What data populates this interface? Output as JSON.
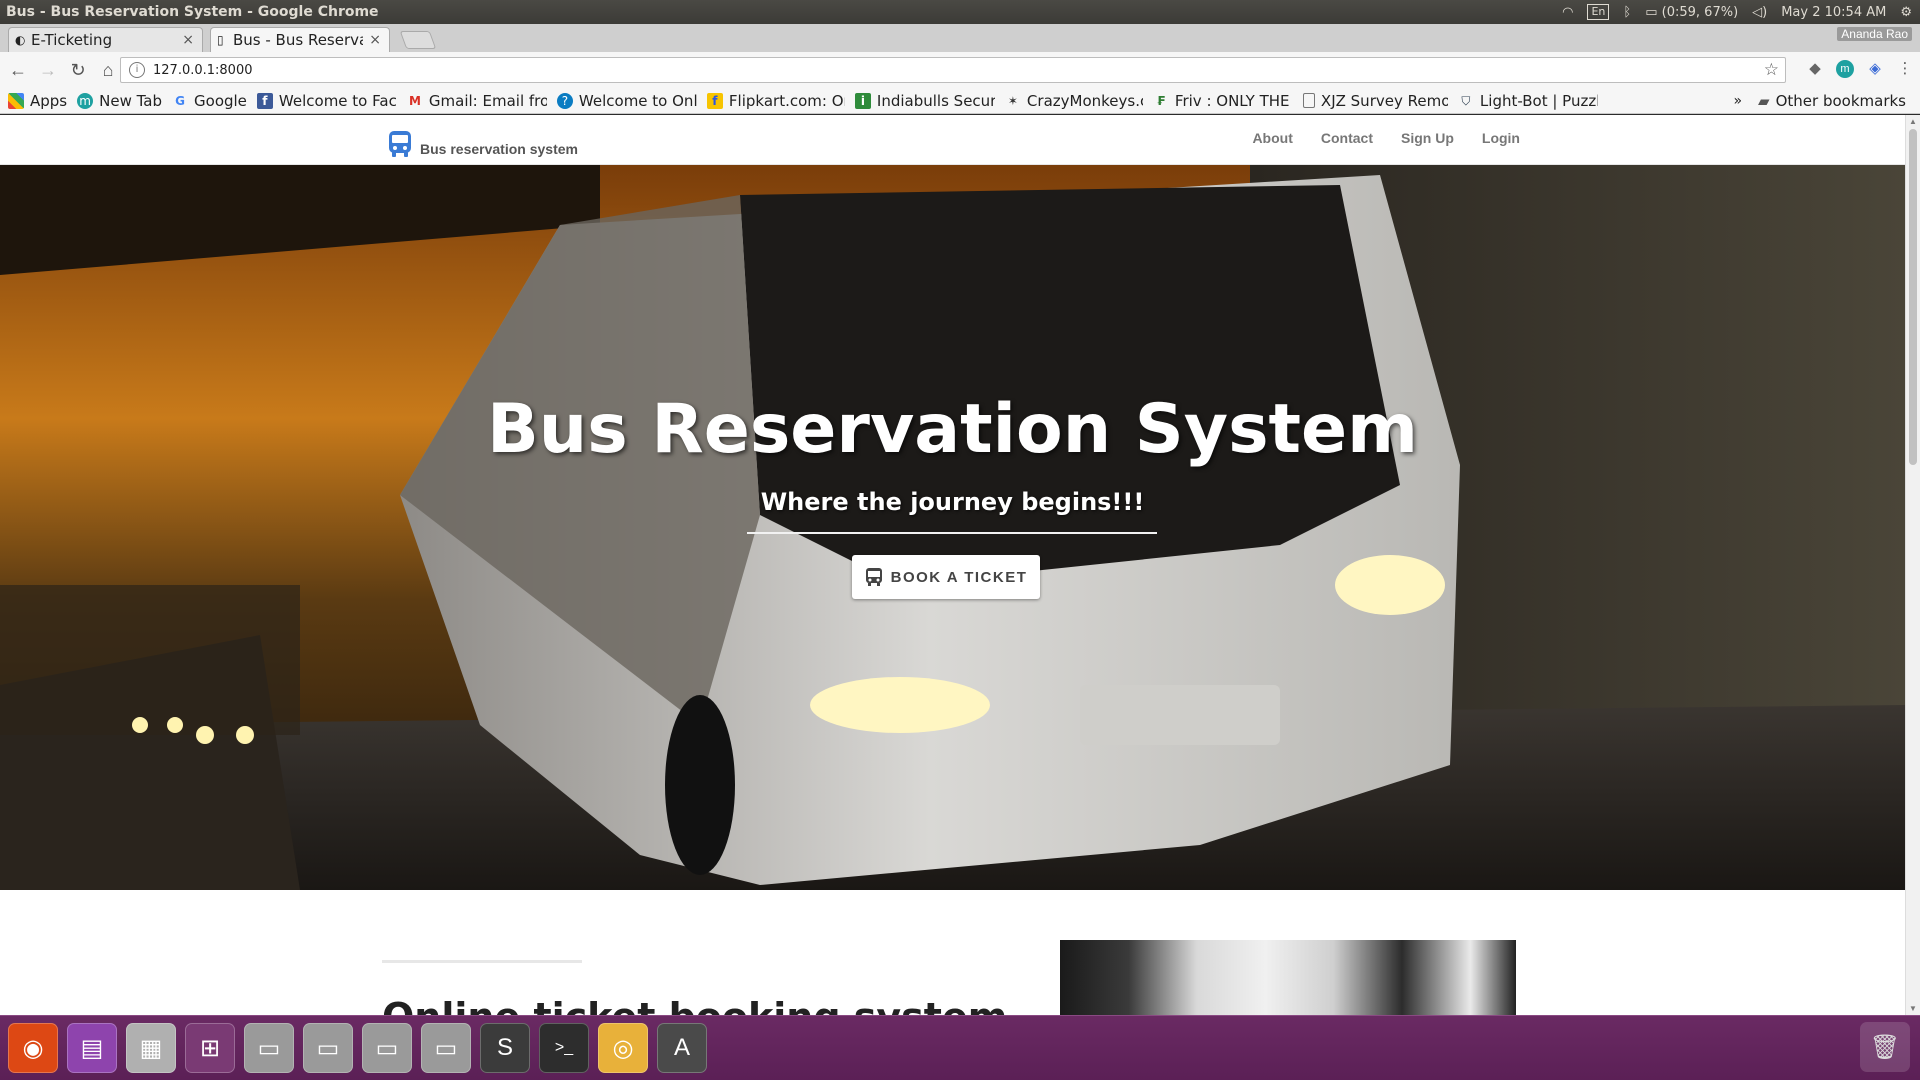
{
  "system": {
    "window_title": "Bus - Bus Reservation System - Google Chrome",
    "keyboard_layout": "En",
    "battery": "(0:59, 67%)",
    "datetime": "May 2 10:54 AM"
  },
  "browser": {
    "tabs": [
      {
        "label": "E-Ticketing",
        "close": "×",
        "icon": "eticket-icon"
      },
      {
        "label": "Bus - Bus Reservati",
        "close": "×",
        "icon": "page-icon"
      }
    ],
    "profile": "Ananda Rao",
    "url": "127.0.0.1:8000",
    "info_glyph": "i",
    "bookmarks": [
      {
        "label": "Apps",
        "icon": "apps-icon",
        "color": "#4285f4"
      },
      {
        "label": "New Tab",
        "icon": "newtab-icon",
        "color": "#1ea1a1"
      },
      {
        "label": "Google",
        "icon": "google-icon",
        "color": "#4285f4"
      },
      {
        "label": "Welcome to Face",
        "icon": "facebook-icon",
        "color": "#3b5998"
      },
      {
        "label": "Gmail: Email fron",
        "icon": "gmail-icon",
        "color": "#d93025"
      },
      {
        "label": "Welcome to Onli",
        "icon": "globe-icon",
        "color": "#0a7cc2"
      },
      {
        "label": "Flipkart.com: On",
        "icon": "flipkart-icon",
        "color": "#f7c400"
      },
      {
        "label": "Indiabulls Securi",
        "icon": "indiabulls-icon",
        "color": "#2e8b3a"
      },
      {
        "label": "CrazyMonkeys.cc",
        "icon": "monkey-icon",
        "color": "#333333"
      },
      {
        "label": "Friv : ONLY THE V",
        "icon": "friv-icon",
        "color": "#2e7d32"
      },
      {
        "label": "XJZ Survey Remo",
        "icon": "page-icon",
        "color": "#777777"
      },
      {
        "label": "Light-Bot | Puzzle",
        "icon": "shield-icon",
        "color": "#2c3e50"
      }
    ],
    "more": "»",
    "other_bookmarks": "Other bookmarks"
  },
  "site": {
    "brand": "Bus reservation system",
    "nav": [
      "About",
      "Contact",
      "Sign Up",
      "Login"
    ],
    "hero": {
      "title": "Bus Reservation System",
      "subtitle": "Where the journey begins!!!",
      "button": "BOOK A TICKET"
    },
    "section_title": "Online ticket booking system"
  },
  "launcher": {
    "apps": [
      {
        "name": "ubuntu-dash-icon",
        "glyph": "◉",
        "color": "#dd4814"
      },
      {
        "name": "files-icon",
        "glyph": "▤",
        "color": "#8e44ad"
      },
      {
        "name": "archive-manager-icon",
        "glyph": "▦",
        "color": "#b0b0b0"
      },
      {
        "name": "workspace-switcher-icon",
        "glyph": "⊞",
        "color": "#7a3a74"
      },
      {
        "name": "disk-icon",
        "glyph": "▭",
        "color": "#9a9a9a"
      },
      {
        "name": "disk-icon",
        "glyph": "▭",
        "color": "#9a9a9a"
      },
      {
        "name": "disk-icon",
        "glyph": "▭",
        "color": "#9a9a9a"
      },
      {
        "name": "disk-icon",
        "glyph": "▭",
        "color": "#9a9a9a"
      },
      {
        "name": "sublime-text-icon",
        "glyph": "S",
        "color": "#3b3b3b"
      },
      {
        "name": "terminal-icon",
        "glyph": ">_",
        "color": "#2d2d2d"
      },
      {
        "name": "chrome-icon",
        "glyph": "◎",
        "color": "#e8b13a"
      },
      {
        "name": "software-updater-icon",
        "glyph": "A",
        "color": "#4a4a4a"
      }
    ],
    "trash_glyph": "🗑"
  },
  "colors": {
    "launcher_bg": "#5b2056",
    "hero_sky": "#c87a1a"
  }
}
